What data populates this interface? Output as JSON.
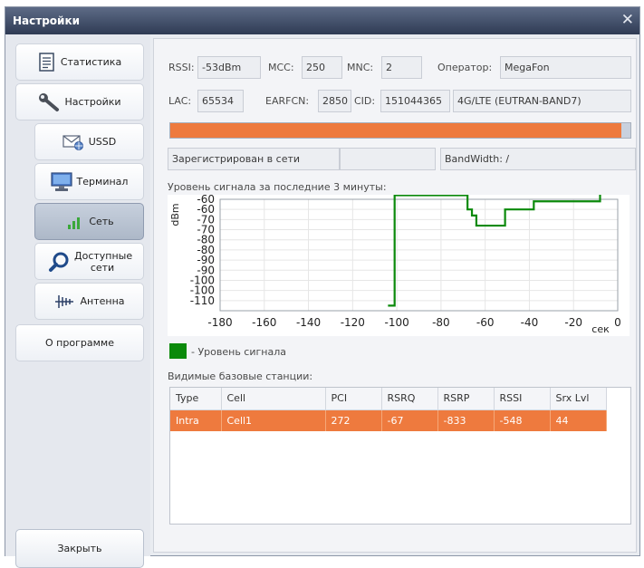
{
  "window": {
    "title": "Настройки",
    "close_glyph": "✕"
  },
  "sidebar": {
    "items": [
      {
        "label": "Статистика",
        "icon": "document-icon"
      },
      {
        "label": "Настройки",
        "icon": "wrench-icon"
      },
      {
        "label": "USSD",
        "icon": "envelope-globe-icon"
      },
      {
        "label": "Терминал",
        "icon": "monitor-icon"
      },
      {
        "label": "Сеть",
        "icon": "signal-bars-icon",
        "selected": true
      },
      {
        "label": "Доступные сети",
        "icon": "magnifier-icon"
      },
      {
        "label": "Антенна",
        "icon": "antenna-icon"
      },
      {
        "label": "О программе"
      }
    ],
    "close_label": "Закрыть"
  },
  "info": {
    "rssi_label": "RSSI:",
    "rssi_value": "-53dBm",
    "mcc_label": "MCC:",
    "mcc_value": "250",
    "mnc_label": "MNC:",
    "mnc_value": "2",
    "operator_label": "Оператор:",
    "operator_value": "MegaFon",
    "lac_label": "LAC:",
    "lac_value": "65534",
    "earfcn_label": "EARFCN:",
    "earfcn_value": "2850",
    "cid_label": "CID:",
    "cid_value": "151044365",
    "band_value": "4G/LTE (EUTRAN-BAND7)",
    "signal_progress": 0.98,
    "status_value": "Зарегистрирован в сети",
    "status_extra": "",
    "bandwidth_value": "BandWidth: /"
  },
  "chart_title": "Уровень сигнала за последние 3 минуты:",
  "chart_data": {
    "type": "line",
    "title": "Уровень сигнала за последние 3 минуты:",
    "xlabel": "сек",
    "ylabel": "dBm",
    "xlim": [
      -180,
      0
    ],
    "ylim": [
      -115,
      -60
    ],
    "xticks": [
      -180,
      -160,
      -140,
      -120,
      -100,
      -80,
      -60,
      -40,
      -20,
      0
    ],
    "yticks": [
      -60,
      -65,
      -70,
      -75,
      -80,
      -85,
      -90,
      -95,
      -100,
      -105,
      -110
    ],
    "ytick_labels": [
      "-60",
      "-60",
      "-70",
      "-70",
      "-80",
      "-80",
      "-90",
      "-90",
      "-100",
      "-100",
      "-110"
    ],
    "grid": true,
    "color": "#0b8a0b",
    "series": [
      {
        "name": "- Уровень сигнала",
        "x": [
          -104,
          -101,
          -101,
          -77,
          -77,
          -68,
          -68,
          -66,
          -66,
          -64,
          -64,
          -51,
          -51,
          -38,
          -38,
          -22,
          -22,
          -8,
          -8,
          1
        ],
        "y": [
          -112.5,
          -112.5,
          -58,
          -58,
          -58,
          -58,
          -65,
          -65,
          -68,
          -68,
          -73,
          -73,
          -65,
          -65,
          -61,
          -61,
          -61,
          -61,
          -56,
          -56
        ]
      }
    ]
  },
  "legend_label": "- Уровень сигнала",
  "stations_title": "Видимые базовые станции:",
  "table": {
    "columns": [
      "Type",
      "Cell",
      "PCI",
      "RSRQ",
      "RSRP",
      "RSSI",
      "Srx Lvl"
    ],
    "rows": [
      [
        "Intra",
        "Cell1",
        "272",
        "-67",
        "-833",
        "-548",
        "44"
      ]
    ]
  }
}
